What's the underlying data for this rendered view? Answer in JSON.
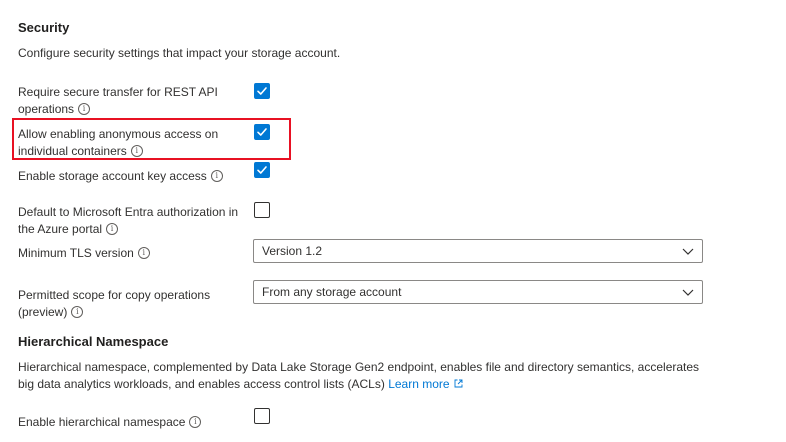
{
  "security": {
    "heading": "Security",
    "description": "Configure security settings that impact your storage account.",
    "settings": [
      {
        "label_line1": "Require secure transfer for REST API",
        "label_line2": "operations",
        "checked": true
      },
      {
        "label_line1": "Allow enabling anonymous access on",
        "label_line2": "individual containers",
        "checked": true
      },
      {
        "label_line1": "Enable storage account key access",
        "checked": true
      },
      {
        "label_line1": "Default to Microsoft Entra authorization in",
        "label_line2": "the Azure portal",
        "checked": false
      }
    ],
    "min_tls": {
      "label": "Minimum TLS version",
      "value": "Version 1.2"
    },
    "copy_scope": {
      "label_line1": "Permitted scope for copy operations",
      "label_line2": "(preview)",
      "value": "From any storage account"
    }
  },
  "hns": {
    "heading": "Hierarchical Namespace",
    "description_line1": "Hierarchical namespace, complemented by Data Lake Storage Gen2 endpoint, enables file and directory semantics, accelerates",
    "description_line2": "big data analytics workloads, and enables access control lists (ACLs)",
    "learn_more": "Learn more",
    "enable_label": "Enable hierarchical namespace",
    "enable_checked": false
  },
  "colors": {
    "accent": "#0078d4",
    "highlight": "#e81123",
    "text": "#323130"
  },
  "icons": {
    "info": "info-circle-icon",
    "check": "checkmark-icon",
    "chevron": "chevron-down-icon",
    "external": "external-link-icon"
  }
}
